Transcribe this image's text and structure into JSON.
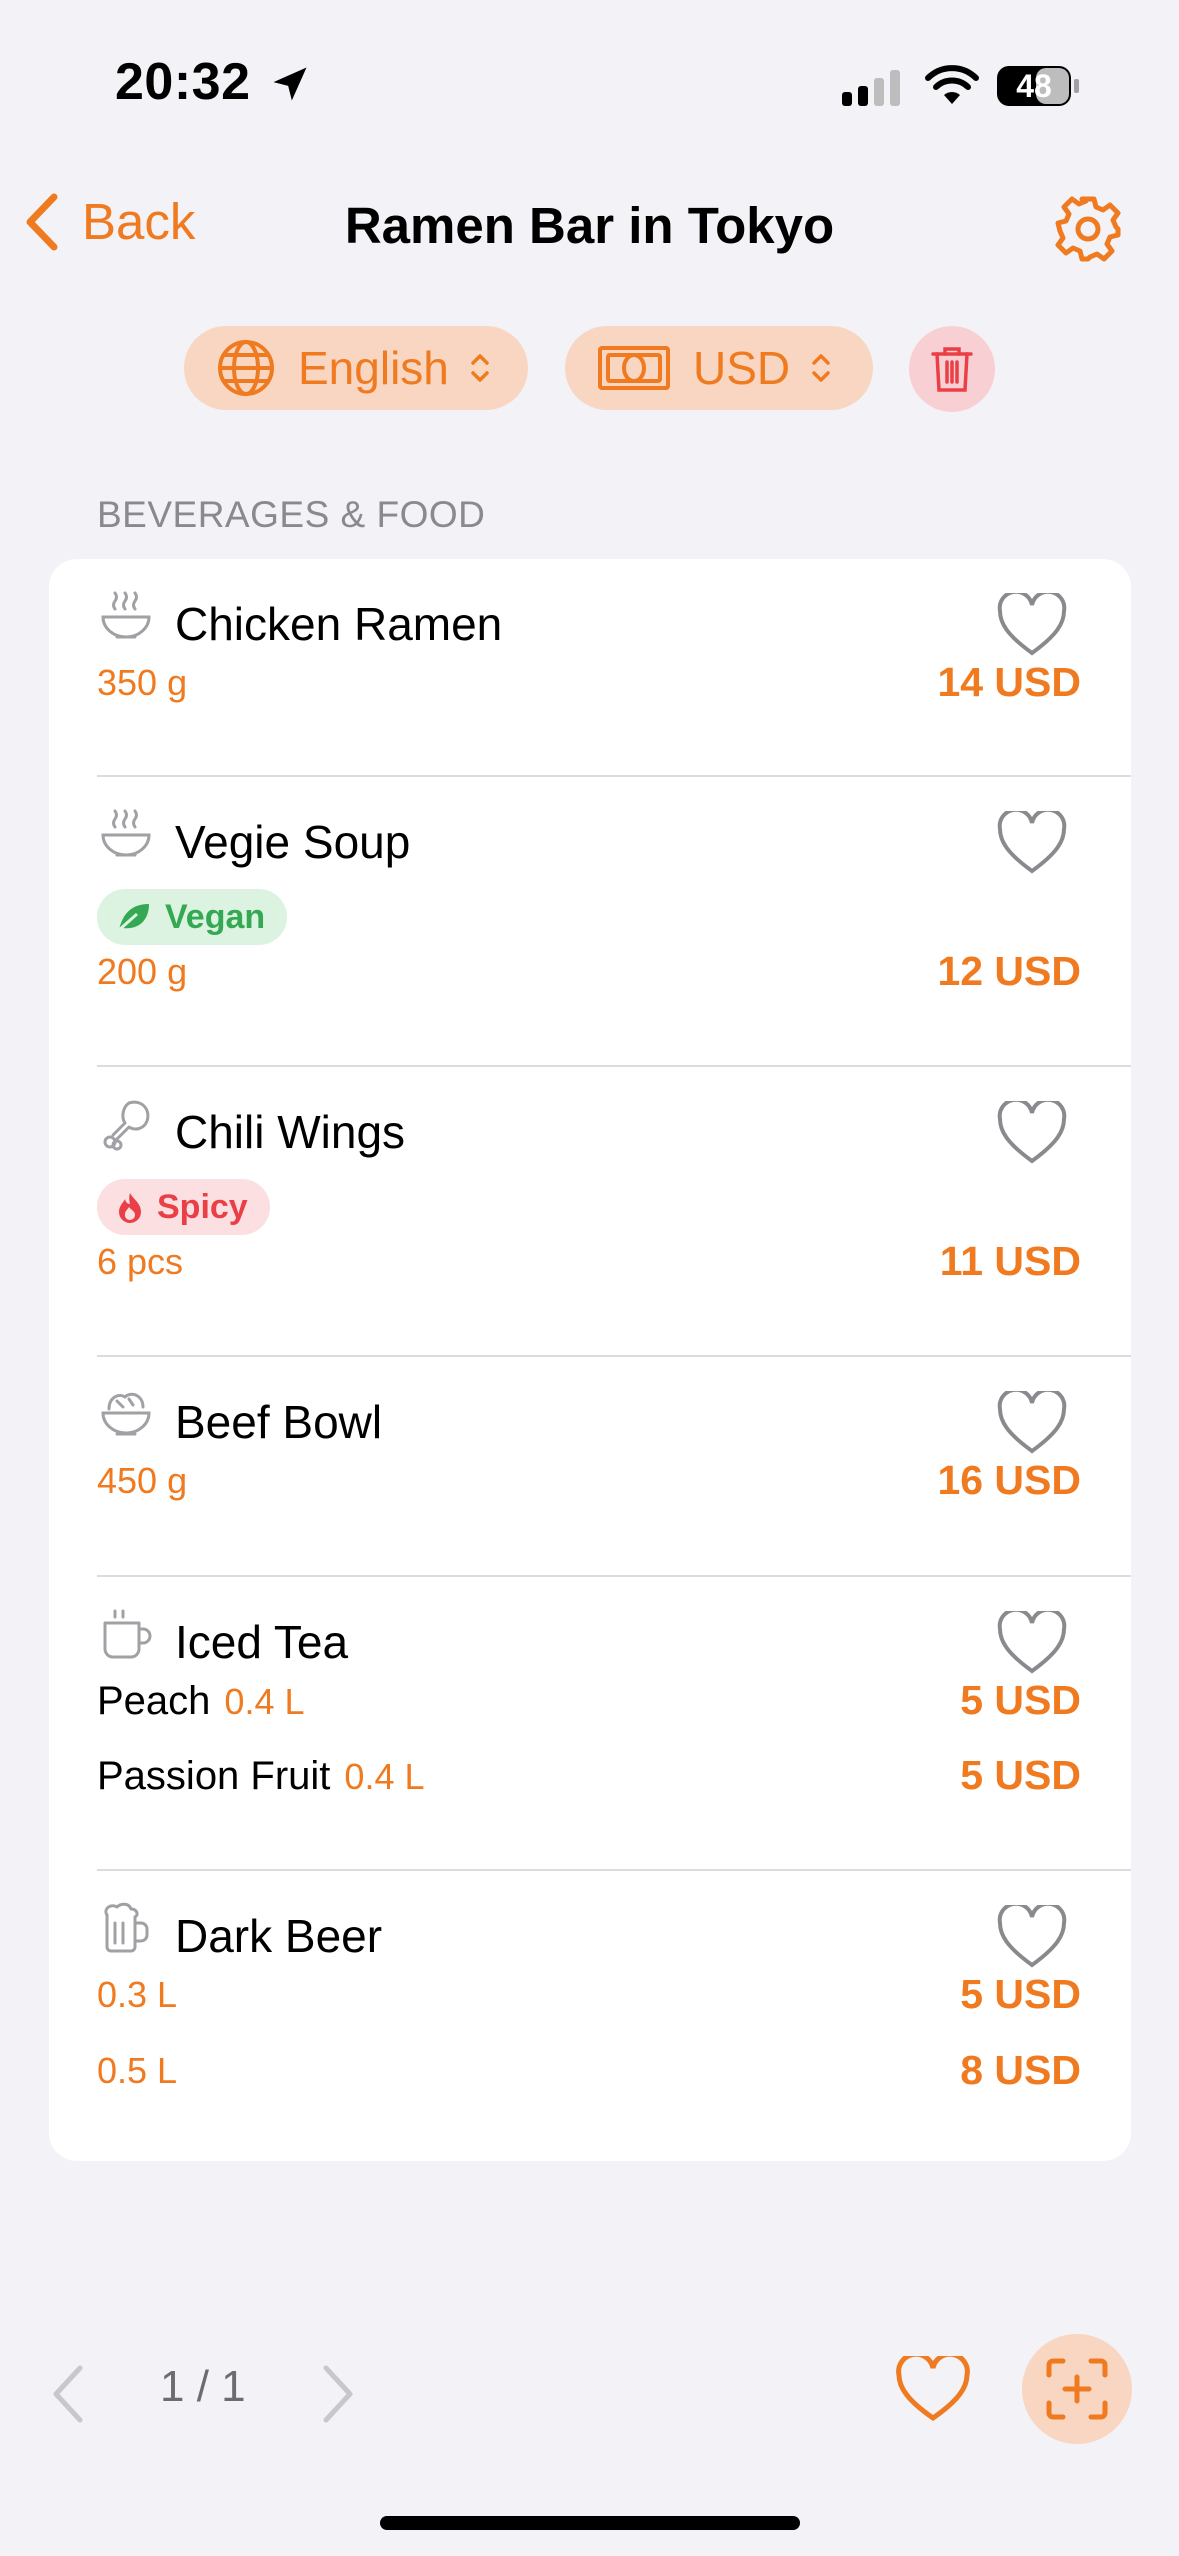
{
  "status_bar": {
    "time": "20:32",
    "battery": "48"
  },
  "nav": {
    "back_label": "Back",
    "title": "Ramen Bar in Tokyo"
  },
  "filters": {
    "language": "English",
    "currency": "USD"
  },
  "section": {
    "header": "BEVERAGES & FOOD"
  },
  "items": [
    {
      "name": "Chicken Ramen",
      "icon": "ramen-bowl-icon",
      "size": "350 g",
      "price": "14 USD"
    },
    {
      "name": "Vegie Soup",
      "icon": "soup-bowl-icon",
      "tag": "Vegan",
      "size": "200 g",
      "price": "12 USD"
    },
    {
      "name": "Chili Wings",
      "icon": "chicken-leg-icon",
      "tag": "Spicy",
      "size": "6 pcs",
      "price": "11 USD"
    },
    {
      "name": "Beef Bowl",
      "icon": "rice-bowl-icon",
      "size": "450 g",
      "price": "16 USD"
    },
    {
      "name": "Iced Tea",
      "icon": "cup-icon",
      "variants": [
        {
          "name": "Peach",
          "size": "0.4 L",
          "price": "5 USD"
        },
        {
          "name": "Passion Fruit",
          "size": "0.4 L",
          "price": "5 USD"
        }
      ]
    },
    {
      "name": "Dark Beer",
      "icon": "beer-mug-icon",
      "variants": [
        {
          "size": "0.3 L",
          "price": "5 USD"
        },
        {
          "size": "0.5 L",
          "price": "8 USD"
        }
      ]
    }
  ],
  "pagination": {
    "label": "1 / 1"
  },
  "colors": {
    "accent": "#f07a1f",
    "vegan": "#34a853",
    "spicy": "#ea3f47",
    "background": "#f2f2f7"
  }
}
